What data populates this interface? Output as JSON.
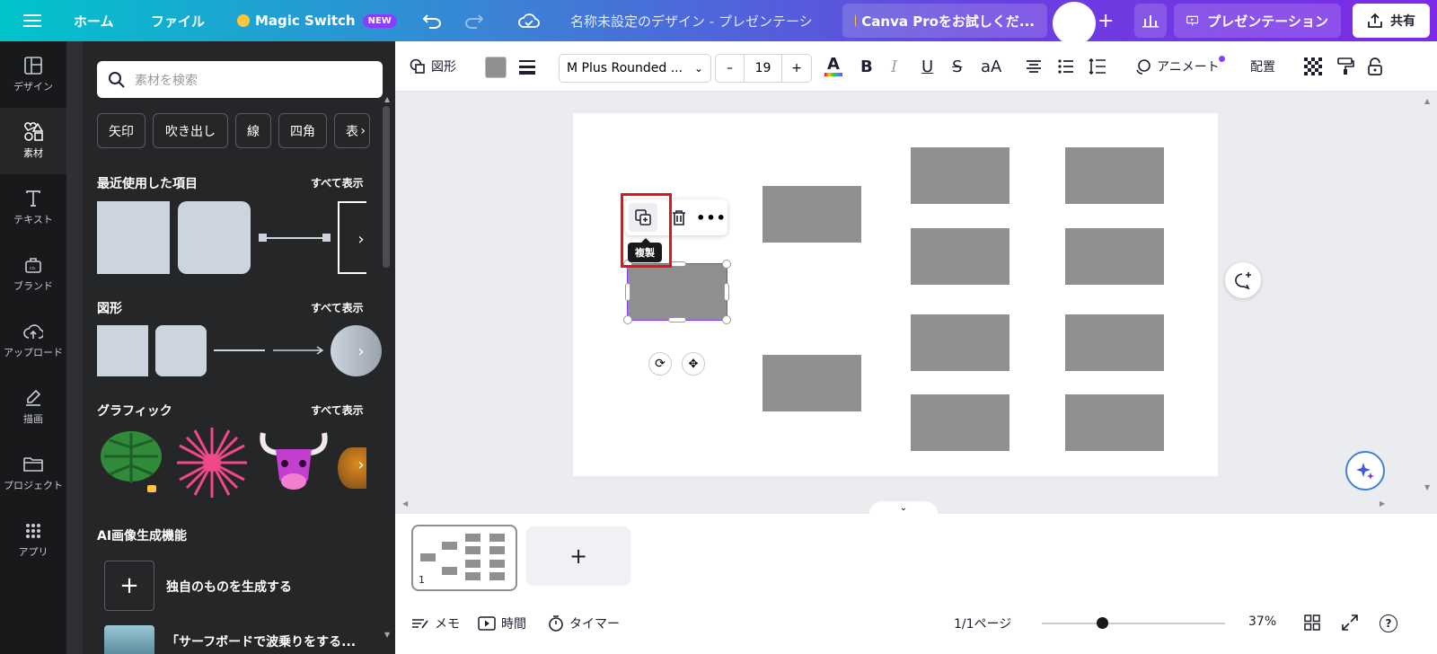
{
  "topbar": {
    "home": "ホーム",
    "file": "ファイル",
    "magic_switch": "Magic Switch",
    "new_badge": "NEW",
    "doc_title": "名称未設定のデザイン - プレゼンテーシ...",
    "canva_pro": "Canva Proをお試しくだ...",
    "present": "プレゼンテーション",
    "share": "共有"
  },
  "leftnav": {
    "items": [
      {
        "label": "デザイン",
        "icon": "layout-icon"
      },
      {
        "label": "素材",
        "icon": "shapes-icon"
      },
      {
        "label": "テキスト",
        "icon": "text-icon"
      },
      {
        "label": "ブランド",
        "icon": "brand-icon"
      },
      {
        "label": "アップロード",
        "icon": "upload-icon"
      },
      {
        "label": "描画",
        "icon": "draw-icon"
      },
      {
        "label": "プロジェクト",
        "icon": "folder-icon"
      },
      {
        "label": "アプリ",
        "icon": "apps-icon"
      }
    ]
  },
  "panel": {
    "search_placeholder": "素材を検索",
    "chips": [
      "矢印",
      "吹き出し",
      "線",
      "四角",
      "表"
    ],
    "recent_title": "最近使用した項目",
    "shapes_title": "図形",
    "graphics_title": "グラフィック",
    "ai_title": "AI画像生成機能",
    "see_all": "すべて表示",
    "generate_label": "独自のものを生成する",
    "surf_label": "「サーフボードで波乗りをする..."
  },
  "toolbar": {
    "shape": "図形",
    "font": "M Plus Rounded ...",
    "size_minus": "–",
    "size_value": "19",
    "size_plus": "+",
    "animate": "アニメート",
    "position": "配置"
  },
  "canvas": {
    "tooltip": "複製"
  },
  "bottom": {
    "page_number": "1",
    "memo": "メモ",
    "time": "時間",
    "timer": "タイマー",
    "page_count": "1/1ページ",
    "zoom": "37%",
    "zoom_fraction": 0.33
  },
  "colors": {
    "accent": "#8b3dff",
    "highlight": "#e0151b",
    "shape_fill": "#8f8f8f"
  }
}
